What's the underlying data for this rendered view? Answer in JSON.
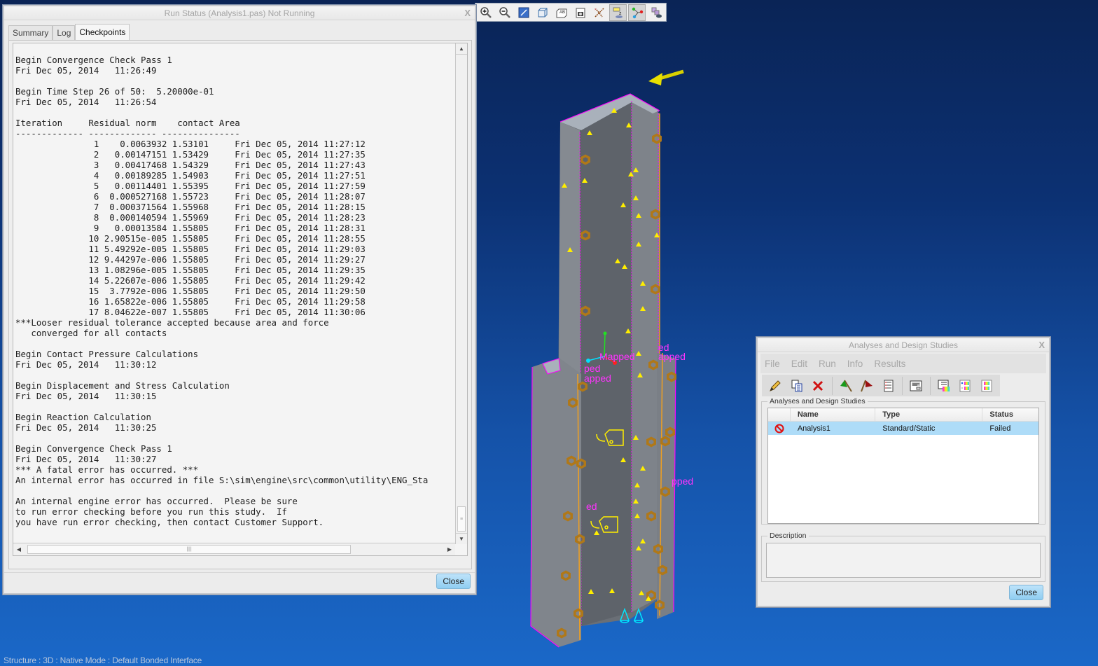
{
  "graphics_toolbar": {
    "buttons": [
      {
        "icon": "zoom-in-icon",
        "active": false
      },
      {
        "icon": "zoom-out-icon",
        "active": false
      },
      {
        "icon": "refit-icon",
        "active": false
      },
      {
        "icon": "display-style-icon",
        "active": false
      },
      {
        "icon": "saved-orientations-icon",
        "active": false
      },
      {
        "icon": "view-manager-icon",
        "active": false
      },
      {
        "icon": "datum-display-icon",
        "active": false
      },
      {
        "icon": "annotation-display-icon",
        "active": true
      },
      {
        "icon": "simulation-display-icon",
        "active": true
      },
      {
        "icon": "appearance-icon",
        "active": false
      }
    ]
  },
  "run_status": {
    "title": "Run Status (Analysis1.pas) Not Running",
    "close_x": "X",
    "tabs": [
      {
        "label": "Summary",
        "active": false
      },
      {
        "label": "Log",
        "active": false
      },
      {
        "label": "Checkpoints",
        "active": true
      }
    ],
    "log": {
      "header_lines": [
        "Begin Convergence Check Pass 1",
        "Fri Dec 05, 2014   11:26:49",
        "",
        "Begin Time Step 26 of 50:  5.20000e-01",
        "Fri Dec 05, 2014   11:26:54",
        ""
      ],
      "columns": [
        "Iteration",
        "Residual norm",
        "contact Area"
      ],
      "rows": [
        {
          "iteration": "1",
          "residual": "0.0063932",
          "area": "1.53101",
          "time": "Fri Dec 05, 2014 11:27:12"
        },
        {
          "iteration": "2",
          "residual": "0.00147151",
          "area": "1.53429",
          "time": "Fri Dec 05, 2014 11:27:35"
        },
        {
          "iteration": "3",
          "residual": "0.00417468",
          "area": "1.54329",
          "time": "Fri Dec 05, 2014 11:27:43"
        },
        {
          "iteration": "4",
          "residual": "0.00189285",
          "area": "1.54903",
          "time": "Fri Dec 05, 2014 11:27:51"
        },
        {
          "iteration": "5",
          "residual": "0.00114401",
          "area": "1.55395",
          "time": "Fri Dec 05, 2014 11:27:59"
        },
        {
          "iteration": "6",
          "residual": "0.000527168",
          "area": "1.55723",
          "time": "Fri Dec 05, 2014 11:28:07"
        },
        {
          "iteration": "7",
          "residual": "0.000371564",
          "area": "1.55968",
          "time": "Fri Dec 05, 2014 11:28:15"
        },
        {
          "iteration": "8",
          "residual": "0.000140594",
          "area": "1.55969",
          "time": "Fri Dec 05, 2014 11:28:23"
        },
        {
          "iteration": "9",
          "residual": "0.00013584",
          "area": "1.55805",
          "time": "Fri Dec 05, 2014 11:28:31"
        },
        {
          "iteration": "10",
          "residual": "2.90515e-005",
          "area": "1.55805",
          "time": "Fri Dec 05, 2014 11:28:55"
        },
        {
          "iteration": "11",
          "residual": "5.49292e-005",
          "area": "1.55805",
          "time": "Fri Dec 05, 2014 11:29:03"
        },
        {
          "iteration": "12",
          "residual": "9.44297e-006",
          "area": "1.55805",
          "time": "Fri Dec 05, 2014 11:29:27"
        },
        {
          "iteration": "13",
          "residual": "1.08296e-005",
          "area": "1.55805",
          "time": "Fri Dec 05, 2014 11:29:35"
        },
        {
          "iteration": "14",
          "residual": "5.22607e-006",
          "area": "1.55805",
          "time": "Fri Dec 05, 2014 11:29:42"
        },
        {
          "iteration": "15",
          "residual": "3.7792e-006",
          "area": "1.55805",
          "time": "Fri Dec 05, 2014 11:29:50"
        },
        {
          "iteration": "16",
          "residual": "1.65822e-006",
          "area": "1.55805",
          "time": "Fri Dec 05, 2014 11:29:58"
        },
        {
          "iteration": "17",
          "residual": "8.04622e-007",
          "area": "1.55805",
          "time": "Fri Dec 05, 2014 11:30:06"
        }
      ],
      "footer_lines": [
        "***Looser residual tolerance accepted because area and force",
        "   converged for all contacts",
        "",
        "Begin Contact Pressure Calculations",
        "Fri Dec 05, 2014   11:30:12",
        "",
        "Begin Displacement and Stress Calculation",
        "Fri Dec 05, 2014   11:30:15",
        "",
        "Begin Reaction Calculation",
        "Fri Dec 05, 2014   11:30:25",
        "",
        "Begin Convergence Check Pass 1",
        "Fri Dec 05, 2014   11:30:27",
        "*** A fatal error has occurred. ***",
        "An internal error has occurred in file S:\\sim\\engine\\src\\common\\utility\\ENG_Sta",
        "",
        "An internal engine error has occurred.  Please be sure",
        "to run error checking before you run this study.  If",
        "you have run error checking, then contact Customer Support."
      ]
    },
    "close_label": "Close"
  },
  "analyses": {
    "title": "Analyses and Design Studies",
    "close_x": "X",
    "menu": [
      "File",
      "Edit",
      "Run",
      "Info",
      "Results"
    ],
    "toolbar": [
      {
        "icon": "edit-pencil-icon"
      },
      {
        "icon": "copy-icon"
      },
      {
        "icon": "delete-icon"
      },
      {
        "sep": true
      },
      {
        "icon": "start-run-flag-icon"
      },
      {
        "icon": "stop-run-flag-icon"
      },
      {
        "icon": "run-status-icon"
      },
      {
        "sep": true
      },
      {
        "icon": "settings-dialog-icon"
      },
      {
        "sep": true
      },
      {
        "icon": "review-results-icon"
      },
      {
        "icon": "compare-results-icon"
      },
      {
        "icon": "results-window-icon"
      }
    ],
    "group_label": "Analyses and Design Studies",
    "columns": [
      "Name",
      "Type",
      "Status"
    ],
    "rows": [
      {
        "status_icon": "failed-icon",
        "name": "Analysis1",
        "type": "Standard/Static",
        "status": "Failed",
        "selected": true
      }
    ],
    "description_label": "Description",
    "description": "",
    "close_label": "Close"
  },
  "viewport": {
    "labels": [
      "Mapped",
      "ped",
      "apped",
      "ed",
      "apped",
      "ed",
      "pped"
    ],
    "colors": {
      "body": "#7d8289",
      "edge": "#ff00ff",
      "bolt": "#b07818",
      "arrow": "#ffee00",
      "constraint": "#00e8ff"
    }
  },
  "statusbar": {
    "text": "Structure : 3D : Native Mode : Default Bonded Interface"
  }
}
